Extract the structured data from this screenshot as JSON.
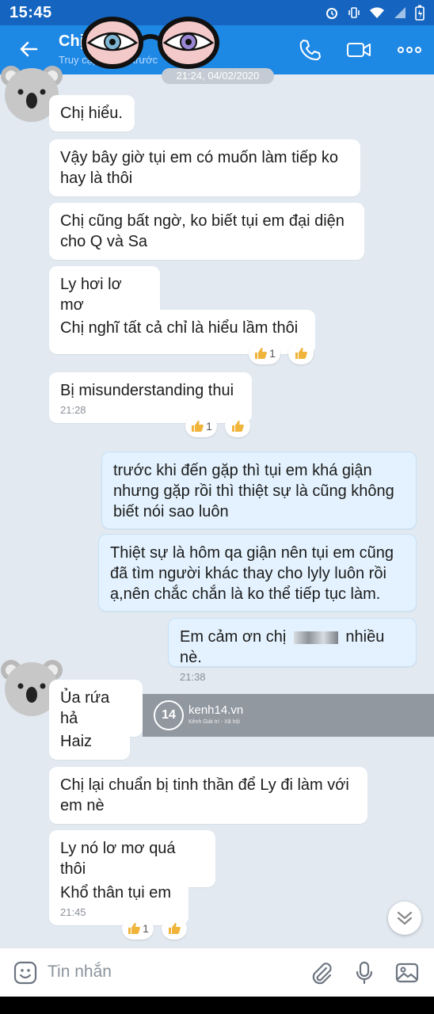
{
  "status_bar": {
    "time": "15:45"
  },
  "header": {
    "title": "Chị",
    "subtitle": "Truy cập 1 phút trước"
  },
  "date_separator": "21:24, 04/02/2020",
  "messages": [
    {
      "text": "Chị hiểu."
    },
    {
      "text": "Vậy bây giờ tụi em có muốn làm tiếp ko hay là thôi"
    },
    {
      "text": "Chị cũng bất ngờ, ko biết tụi em đại diện cho Q và Sa"
    },
    {
      "text": "Ly hơi lơ mơ"
    },
    {
      "text": "Chị nghĩ tất cả chỉ là hiểu lầm thôi",
      "reaction_count": "1"
    },
    {
      "text": "Bị misunderstanding thui",
      "time": "21:28",
      "reaction_count": "1"
    },
    {
      "text": "trước khi đến gặp thì tụi em khá giận nhưng gặp rồi thì thiệt sự là cũng không biết nói sao luôn"
    },
    {
      "text": "Thiệt sự là hôm qa giận nên tụi em cũng đã tìm người khác thay cho lyly luôn rồi ạ,nên chắc chắn là ko thể tiếp tục làm."
    },
    {
      "text": "Em cảm ơn chị",
      "text_after": "nhiều nè.",
      "time": "21:38"
    },
    {
      "text": "Ủa rứa hả"
    },
    {
      "text": "Haiz"
    },
    {
      "text": "Chị lại chuẩn bị tinh thần để Ly đi làm với em nè"
    },
    {
      "text": "Ly nó lơ mơ quá thôi"
    },
    {
      "text": "Khổ thân tụi em",
      "time": "21:45",
      "reaction_count": "1"
    }
  ],
  "watermark": {
    "logo": "14",
    "brand": "kenh14.vn",
    "tagline": "Kênh Giải trí - Xã hội"
  },
  "composer": {
    "placeholder": "Tin nhắn"
  },
  "colors": {
    "header": "#1e88e5",
    "status_bar": "#1565c0",
    "chat_bg": "#e2e9f1",
    "outgoing_bubble": "#e3f2fe"
  }
}
